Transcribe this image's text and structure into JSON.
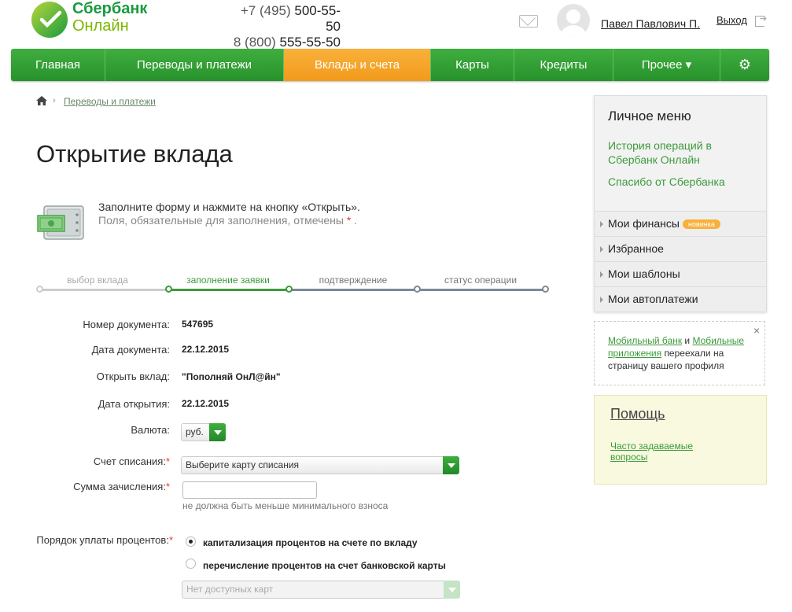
{
  "header": {
    "logo_line1": "Сбербанк",
    "logo_line2": "Онлайн",
    "phone1_prefix": "+7 (495)",
    "phone1_number": "500-55-50",
    "phone2_prefix": "8 (800)",
    "phone2_number": "555-55-50",
    "username": "Павел Павлович П.",
    "logout": "Выход"
  },
  "nav": {
    "items": [
      {
        "label": "Главная"
      },
      {
        "label": "Переводы и платежи"
      },
      {
        "label": "Вклады и счета"
      },
      {
        "label": "Карты"
      },
      {
        "label": "Кредиты"
      },
      {
        "label": "Прочее ▾"
      }
    ]
  },
  "breadcrumb": {
    "link": "Переводы и платежи"
  },
  "page": {
    "title": "Открытие вклада",
    "intro_line1": "Заполните форму и нажмите на кнопку «Открыть».",
    "intro_line2_prefix": "Поля, обязательные для заполнения, отмечены",
    "intro_asterisk": "*",
    "intro_line2_suffix": "."
  },
  "steps": [
    {
      "label": "выбор вклада"
    },
    {
      "label": "заполнение заявки"
    },
    {
      "label": "подтверждение"
    },
    {
      "label": "статус операции"
    }
  ],
  "form": {
    "doc_number_label": "Номер документа:",
    "doc_number_value": "547695",
    "doc_date_label": "Дата документа:",
    "doc_date_value": "22.12.2015",
    "deposit_label": "Открыть вклад:",
    "deposit_value": "\"Пополняй ОнЛ@йн\"",
    "open_date_label": "Дата открытия:",
    "open_date_value": "22.12.2015",
    "currency_label": "Валюта:",
    "currency_value": "руб.",
    "account_label": "Счет списания:",
    "account_value": "Выберите карту списания",
    "amount_label": "Сумма зачисления:",
    "amount_value": "",
    "amount_hint": "не должна быть меньше минимального взноса",
    "interest_label": "Порядок уплаты процентов:",
    "interest_opt1": "капитализация процентов на счете по вкладу",
    "interest_opt2": "перечисление процентов на счет банковской карты",
    "cards_value": "Нет доступных карт",
    "asterisk": "*"
  },
  "sidebar": {
    "title": "Личное меню",
    "link1_line1": "История операций в",
    "link1_line2": "Сбербанк Онлайн",
    "link2": "Спасибо от Сбербанка",
    "items": [
      {
        "label": "Мои финансы",
        "badge": "новинка"
      },
      {
        "label": "Избранное"
      },
      {
        "label": "Мои шаблоны"
      },
      {
        "label": "Мои автоплатежи"
      }
    ],
    "notice_link1": "Мобильный банк",
    "notice_and": "и",
    "notice_link2": "Мобильные приложения",
    "notice_rest": "переехали на страницу вашего профиля",
    "notice_close": "×",
    "help_title": "Помощь",
    "help_link": "Часто задаваемые вопросы"
  },
  "colors": {
    "brand_green": "#2e9e34",
    "accent_orange": "#f5a623",
    "link_green": "#3c9a3c"
  }
}
